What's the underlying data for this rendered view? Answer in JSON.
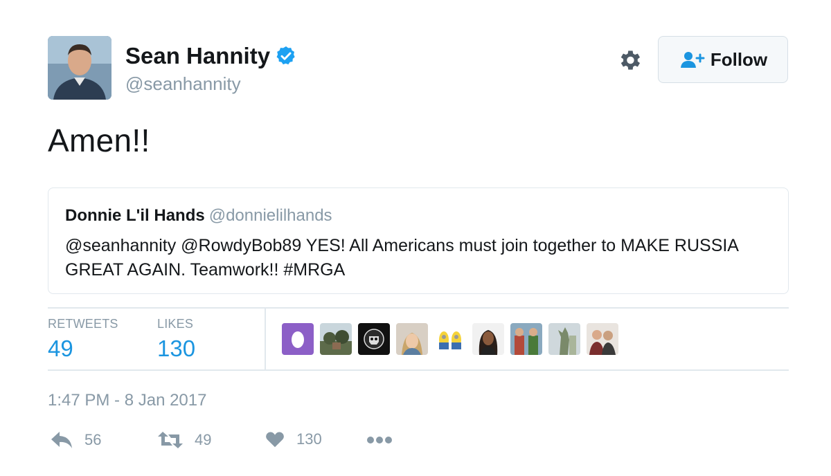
{
  "author": {
    "name": "Sean Hannity",
    "handle": "@seanhannity",
    "verified": true
  },
  "header": {
    "follow_label": "Follow"
  },
  "tweet": {
    "text": "Amen!!"
  },
  "quoted_tweet": {
    "name": "Donnie L'il Hands",
    "handle": "@donnielilhands",
    "text": "@seanhannity @RowdyBob89 YES! All Americans must join together to MAKE RUSSIA GREAT AGAIN.  Teamwork!!  #MRGA"
  },
  "stats": {
    "retweets_label": "RETWEETS",
    "retweets_value": "49",
    "likes_label": "LIKES",
    "likes_value": "130"
  },
  "timestamp": "1:47 PM - 8 Jan 2017",
  "actions": {
    "reply_count": "56",
    "retweet_count": "49",
    "like_count": "130"
  },
  "colors": {
    "link_blue": "#1b95e0",
    "muted_gray": "#8899a6",
    "verified_blue": "#1da1f2",
    "border": "#e1e8ed"
  },
  "icons": [
    "gear-icon",
    "follow-person-icon",
    "verified-badge-icon",
    "reply-icon",
    "retweet-icon",
    "heart-icon",
    "more-icon"
  ]
}
